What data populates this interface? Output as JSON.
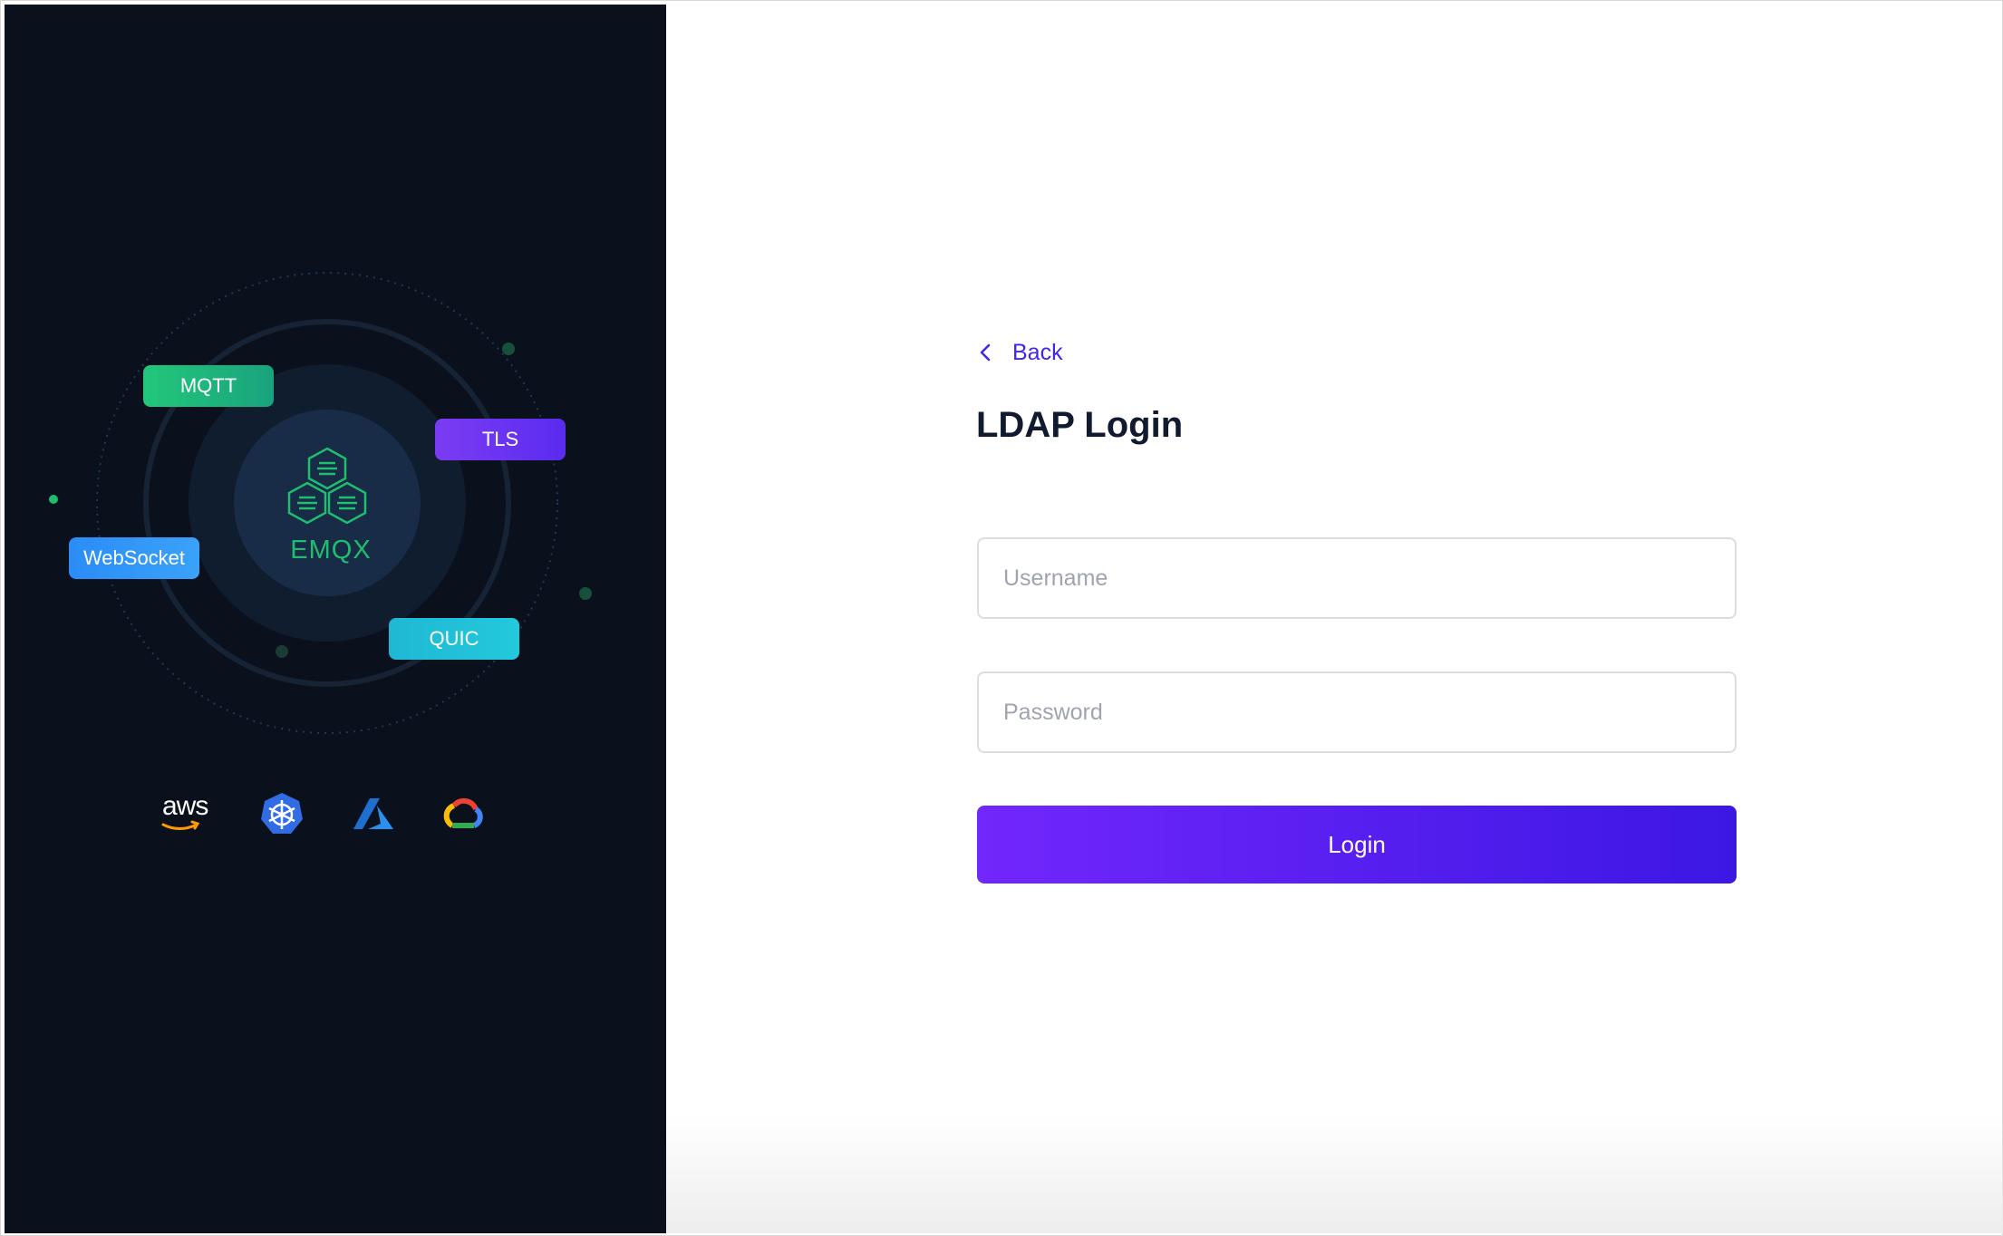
{
  "brand": {
    "product_name": "EMQX",
    "protocols": [
      "MQTT",
      "TLS",
      "WebSocket",
      "QUIC"
    ],
    "cloud_providers": [
      "aws",
      "kubernetes-icon",
      "azure-icon",
      "google-cloud-icon"
    ],
    "aws_label": "aws"
  },
  "login": {
    "back_label": "Back",
    "title": "LDAP Login",
    "username_placeholder": "Username",
    "password_placeholder": "Password",
    "submit_label": "Login"
  },
  "colors": {
    "accent": "#3f27ee",
    "button_gradient_start": "#7227fb",
    "button_gradient_end": "#3c17e4",
    "left_panel_bg": "#0a111c",
    "brand_green": "#1fbd6e"
  }
}
